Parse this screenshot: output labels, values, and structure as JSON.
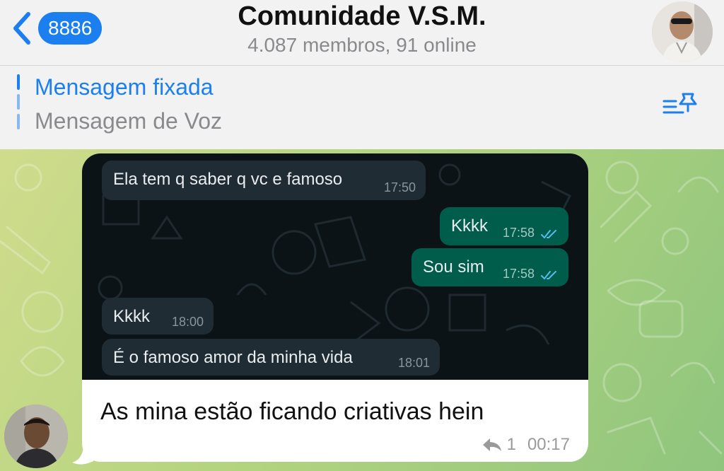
{
  "header": {
    "back_count": "8886",
    "title": "Comunidade V.S.M.",
    "subtitle": "4.087 membros, 91 online"
  },
  "pinned": {
    "title": "Mensagem fixada",
    "message": "Mensagem de Voz"
  },
  "screenshot_messages": [
    {
      "direction": "in",
      "text": "Ela tem q saber q vc e famoso",
      "time": "17:50"
    },
    {
      "direction": "out",
      "text": "Kkkk",
      "time": "17:58"
    },
    {
      "direction": "out",
      "text": "Sou sim",
      "time": "17:58"
    },
    {
      "direction": "in",
      "text": "Kkkk",
      "time": "18:00"
    },
    {
      "direction": "in",
      "text": "É o famoso amor da minha vida",
      "time": "18:01"
    }
  ],
  "message": {
    "caption": "As mina estão ficando criativas hein",
    "replies": "1",
    "time": "00:17"
  },
  "colors": {
    "accent": "#1c7ff0",
    "wa_incoming": "#202c33",
    "wa_outgoing": "#005c4b",
    "wa_background": "#0c1317"
  }
}
